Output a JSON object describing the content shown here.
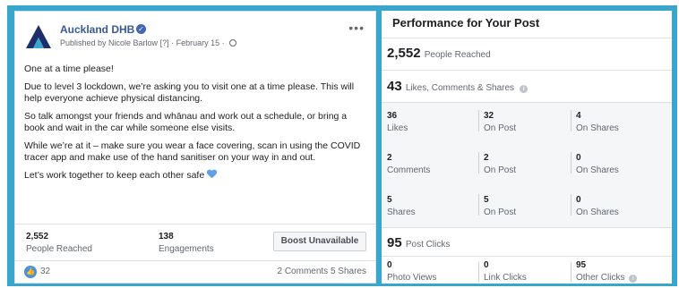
{
  "post": {
    "page_name": "Auckland DHB",
    "published_by": "Published by Nicole Barlow",
    "help_marker": "[?]",
    "date": "February 15",
    "more_label": "•••",
    "paragraphs": [
      "One at a time please!",
      "Due to level 3 lockdown, we’re asking you to visit one at a time please. This will help everyone achieve physical distancing.",
      "So talk amongst your friends and whānau and work out a schedule, or bring a book and wait in the car while someone else visits.",
      "While we’re at it – make sure you wear a face covering, scan in using the COVID tracer app and make use of the hand sanitiser on your way in and out.",
      "Let’s work together to keep each other safe"
    ],
    "people_reached_value": "2,552",
    "people_reached_label": "People Reached",
    "engagements_value": "138",
    "engagements_label": "Engagements",
    "boost_label": "Boost Unavailable",
    "like_count": "32",
    "comments_shares": "2 Comments  5 Shares"
  },
  "performance": {
    "title": "Performance for Your Post",
    "reached_value": "2,552",
    "reached_label": "People Reached",
    "lcs_value": "43",
    "lcs_label": "Likes, Comments & Shares",
    "grid_rows": [
      {
        "cells": [
          {
            "n": "36",
            "l": "Likes"
          },
          {
            "n": "32",
            "l": "On Post"
          },
          {
            "n": "4",
            "l": "On Shares"
          }
        ]
      },
      {
        "cells": [
          {
            "n": "2",
            "l": "Comments"
          },
          {
            "n": "2",
            "l": "On Post"
          },
          {
            "n": "0",
            "l": "On Shares"
          }
        ]
      },
      {
        "cells": [
          {
            "n": "5",
            "l": "Shares"
          },
          {
            "n": "5",
            "l": "On Post"
          },
          {
            "n": "0",
            "l": "On Shares"
          }
        ]
      }
    ],
    "clicks_value": "95",
    "clicks_label": "Post Clicks",
    "click_cells": [
      {
        "n": "0",
        "l": "Photo Views"
      },
      {
        "n": "0",
        "l": "Link Clicks"
      },
      {
        "n": "95",
        "l": "Other Clicks"
      }
    ]
  },
  "colors": {
    "frame": "#3aa6cc",
    "link_blue": "#385898",
    "grey_text": "#606770"
  },
  "icons": [
    "auckland-dhb-logo",
    "verified-badge-icon",
    "globe-icon",
    "more-icon",
    "heart-emoji-icon",
    "like-icon",
    "info-icon"
  ]
}
